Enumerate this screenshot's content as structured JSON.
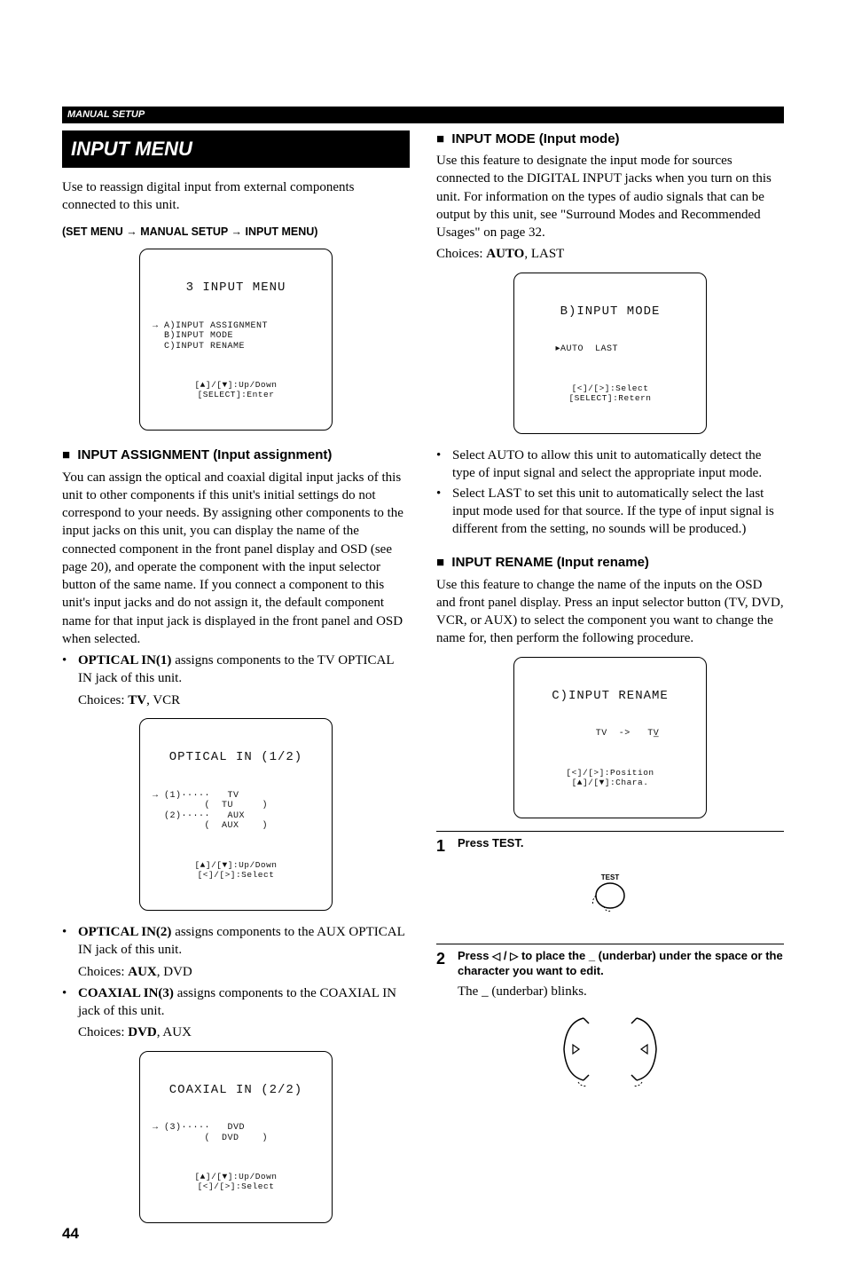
{
  "header": {
    "section": "MANUAL SETUP"
  },
  "left": {
    "title": "INPUT MENU",
    "intro": "Use to reassign digital input from external components connected to this unit.",
    "path": "(SET MENU → MANUAL SETUP → INPUT MENU)",
    "lcd_main": {
      "title": "3 INPUT MENU",
      "body": "→ A)INPUT ASSIGNMENT\n  B)INPUT MODE\n  C)INPUT RENAME",
      "foot": "[▲]/[▼]:Up/Down\n[SELECT]:Enter"
    },
    "assign_head": "INPUT ASSIGNMENT (Input assignment)",
    "assign_body": "You can assign the optical and coaxial digital input jacks of this unit to other components if this unit's initial settings do not correspond to your needs. By assigning other components to the input jacks on this unit, you can display the name of the connected component in the front panel display and OSD (see page 20), and operate the component with the input selector button of the same name. If you connect a component to this unit's input jacks and do not assign it, the default component name for that input jack is displayed in the front panel and OSD when selected.",
    "opt1_bold": "OPTICAL IN(1)",
    "opt1_text": " assigns components to the TV OPTICAL IN jack of this unit.",
    "opt1_choices_label": "Choices: ",
    "opt1_choices_bold": "TV",
    "opt1_choices_rest": ", VCR",
    "lcd_opt1": {
      "title": "OPTICAL IN (1/2)",
      "body": "→ (1)·····   TV\n         (  TU     )\n  (2)·····   AUX\n         (  AUX    )",
      "foot": "[▲]/[▼]:Up/Down\n[<]/[>]:Select"
    },
    "opt2_bold": "OPTICAL IN(2)",
    "opt2_text": " assigns components to the AUX OPTICAL IN jack of this unit.",
    "opt2_choices_label": "Choices: ",
    "opt2_choices_bold": "AUX",
    "opt2_choices_rest": ", DVD",
    "coax_bold": "COAXIAL IN(3)",
    "coax_text": " assigns components to the COAXIAL IN jack of this unit.",
    "coax_choices_label": "Choices: ",
    "coax_choices_bold": "DVD",
    "coax_choices_rest": ", AUX",
    "lcd_coax": {
      "title": "COAXIAL IN (2/2)",
      "body": "→ (3)·····   DVD\n         (  DVD    )",
      "foot": "[▲]/[▼]:Up/Down\n[<]/[>]:Select"
    }
  },
  "right": {
    "mode_head": "INPUT MODE (Input mode)",
    "mode_body": "Use this feature to designate the input mode for sources connected to the DIGITAL INPUT jacks when you turn on this unit. For information on the types of audio signals that can be output by this unit, see \"Surround Modes and Recommended Usages\" on page 32.",
    "mode_choices_label": "Choices: ",
    "mode_choices_bold": "AUTO",
    "mode_choices_rest": ", LAST",
    "lcd_mode": {
      "title": "B)INPUT MODE",
      "body": "     ▸AUTO  LAST",
      "foot": "[<]/[>]:Select\n[SELECT]:Retern"
    },
    "mode_b1": "Select AUTO to allow this unit to automatically detect the type of input signal and select the appropriate input mode.",
    "mode_b2": "Select LAST to set this unit to automatically select the last input mode used for that source. If the type of input signal is different from the setting, no sounds will be produced.)",
    "rename_head": "INPUT RENAME (Input rename)",
    "rename_body": "Use this feature to change the name of the inputs on the OSD and front panel display. Press an input selector button (TV, DVD, VCR, or AUX) to select the component you want to change the name for, then  perform the following procedure.",
    "lcd_rename": {
      "title": "C)INPUT RENAME",
      "body": "      TV  ->   TV̲",
      "foot": "[<]/[>]:Position\n[▲]/[▼]:Chara."
    },
    "step1_num": "1",
    "step1_text": "Press TEST.",
    "test_label": "TEST",
    "step2_num": "2",
    "step2_text_a": "Press ",
    "step2_text_b": " / ",
    "step2_text_c": " to place the _ (underbar) under the space or the character you want to edit.",
    "step2_body": "The _ (underbar) blinks."
  },
  "page_number": "44"
}
